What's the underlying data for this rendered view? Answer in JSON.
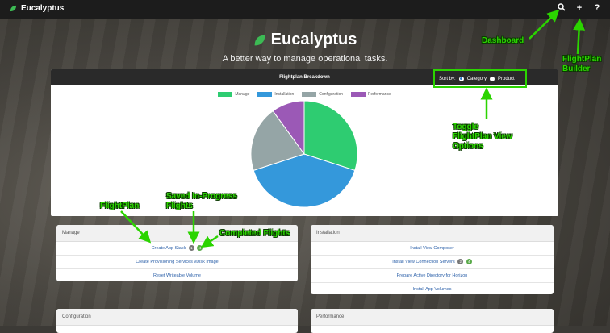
{
  "app": {
    "title": "Eucalyptus"
  },
  "topbar": {
    "search_icon": "search-icon",
    "add_icon": "+",
    "help_icon": "?"
  },
  "hero": {
    "title": "Eucalyptus",
    "subtitle": "A better way to manage operational tasks."
  },
  "breakdown": {
    "title": "Flightplan Breakdown",
    "sort_label": "Sort by:",
    "sort_options": [
      "Category",
      "Product"
    ],
    "sort_selected": "Category"
  },
  "chart_data": {
    "type": "pie",
    "title": "",
    "legend_position": "top",
    "categories": [
      "Manage",
      "Installation",
      "Configuration",
      "Performance"
    ],
    "values": [
      3,
      4,
      2,
      1
    ],
    "colors": [
      "#2ecc71",
      "#3498db",
      "#95a5a6",
      "#9b59b6"
    ]
  },
  "cards": {
    "manage": {
      "title": "Manage",
      "items": [
        {
          "label": "Create App Stack",
          "saved": "1",
          "completed": "4"
        },
        {
          "label": "Create Provisioning Services vDisk Image"
        },
        {
          "label": "Reset Writeable Volume"
        }
      ]
    },
    "installation": {
      "title": "Installation",
      "items": [
        {
          "label": "Install View Composer"
        },
        {
          "label": "Install View Connection Servers",
          "saved": "2",
          "completed": "4"
        },
        {
          "label": "Prepare Active Directory for Horizon"
        },
        {
          "label": "Install App Volumes"
        }
      ]
    },
    "configuration": {
      "title": "Configuration"
    },
    "performance": {
      "title": "Performance"
    }
  },
  "callouts": {
    "dashboard": "Dashboard",
    "flightplan_builder": "FlightPlan\nBuilder",
    "toggle": "Toggle\nFlightPlan View\nOptions",
    "flightplan": "FlightPlan",
    "saved": "Saved In-Progress\nFlights",
    "completed": "Completed Flights"
  },
  "accent": "#2bd400"
}
